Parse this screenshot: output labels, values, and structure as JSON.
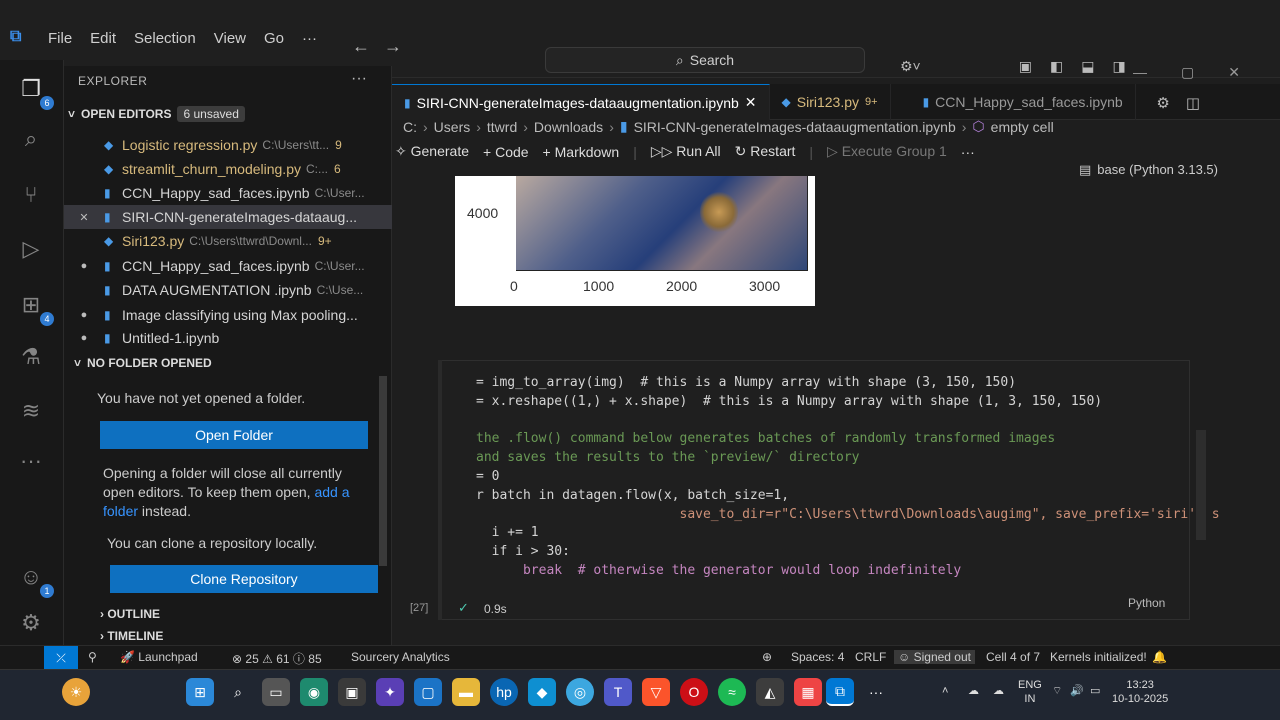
{
  "menu": [
    "File",
    "Edit",
    "Selection",
    "View",
    "Go",
    "···"
  ],
  "search": {
    "label": "Search"
  },
  "sidebar": {
    "header": "EXPLORER",
    "open_editors": {
      "title": "OPEN EDITORS",
      "unsaved": "6 unsaved",
      "items": [
        {
          "name": "Logistic regression.py",
          "path": "C:\\Users\\tt...",
          "count": "9"
        },
        {
          "name": "streamlit_churn_modeling.py",
          "path": "C:...",
          "count": "6"
        },
        {
          "name": "CCN_Happy_sad_faces.ipynb",
          "path": "C:\\User...",
          "count": ""
        },
        {
          "name": "SIRI-CNN-generateImages-dataaug...",
          "path": "",
          "count": ""
        },
        {
          "name": "Siri123.py",
          "path": "C:\\Users\\ttwrd\\Downl...",
          "count": "9+"
        },
        {
          "name": "CCN_Happy_sad_faces.ipynb",
          "path": "C:\\User...",
          "count": ""
        },
        {
          "name": "DATA AUGMENTATION .ipynb",
          "path": "C:\\Use...",
          "count": ""
        },
        {
          "name": "Image classifying using Max pooling...",
          "path": "",
          "count": ""
        },
        {
          "name": "Untitled-1.ipynb",
          "path": "",
          "count": ""
        }
      ]
    },
    "no_folder": {
      "title": "NO FOLDER OPENED",
      "message": "You have not yet opened a folder.",
      "open_button": "Open Folder",
      "info_before": "Opening a folder will close all currently open editors. To keep them open,",
      "info_link": "add a folder",
      "info_after": "instead.",
      "clone_text": "You can clone a repository locally.",
      "clone_button": "Clone Repository"
    },
    "outline": "OUTLINE",
    "timeline": "TIMELINE"
  },
  "tabs": [
    {
      "label": "SIRI-CNN-generateImages-dataaugmentation.ipynb",
      "close": "✕"
    },
    {
      "label": "Siri123.py",
      "count": "9+"
    },
    {
      "label": "CCN_Happy_sad_faces.ipynb"
    }
  ],
  "breadcrumb": [
    "C:",
    "Users",
    "ttwrd",
    "Downloads",
    "SIRI-CNN-generateImages-dataaugmentation.ipynb",
    "empty cell"
  ],
  "toolbar": {
    "generate": "Generate",
    "code": "Code",
    "markdown": "Markdown",
    "run_all": "Run All",
    "restart": "Restart",
    "execute_group": "Execute Group 1",
    "more": "···"
  },
  "kernel": "base (Python 3.13.5)",
  "plot": {
    "ytick": "4000",
    "xticks": [
      "0",
      "1000",
      "2000",
      "3000"
    ]
  },
  "cell": {
    "exec_count": "[27]",
    "time": "0.9s",
    "language": "Python",
    "lines": [
      "= img_to_array(img)  # this is a Numpy array with shape (3, 150, 150)",
      "= x.reshape((1,) + x.shape)  # this is a Numpy array with shape (1, 3, 150, 150)",
      "",
      "the .flow() command below generates batches of randomly transformed images",
      "and saves the results to the `preview/` directory",
      "= 0",
      "r batch in datagen.flow(x, batch_size=1,",
      "                          save_to_dir=r\"C:\\Users\\ttwrd\\Downloads\\augimg\", save_prefix='siri', s",
      "  i += 1",
      "  if i > 30:",
      "      break  # otherwise the generator would loop indefinitely"
    ]
  },
  "statusbar": {
    "launchpad": "Launchpad",
    "errors": "25",
    "warnings": "61",
    "info": "85",
    "sourcery": "Sourcery Analytics",
    "spaces": "Spaces: 4",
    "eol": "CRLF",
    "signed_out": "Signed out",
    "cell": "Cell 4 of 7",
    "kernels": "Kernels initialized!"
  },
  "tray": {
    "lang": "ENG",
    "region": "IN",
    "time": "13:23",
    "date": "10-10-2025"
  },
  "badges": {
    "explorer": "6",
    "extensions": "4",
    "account": "1"
  }
}
